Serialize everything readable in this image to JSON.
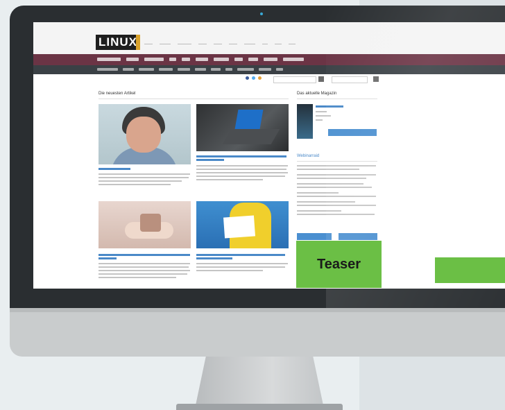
{
  "colors": {
    "accent_green": "#6bbf45",
    "nav_primary": "#6b3445",
    "nav_secondary": "#3a4045",
    "link_blue": "#4a89c8",
    "bezel": "#2a2e31"
  },
  "site": {
    "logo_text": "LINUX",
    "latest_heading": "Die neuesten Artikel",
    "magazine_heading": "Das aktuelle Magazin",
    "webinar_heading": "Webinarraid"
  },
  "overlay": {
    "teaser_label": "Teaser"
  },
  "icons": {
    "camera": "camera-dot-icon",
    "search": "search-icon",
    "menu": "menu-icon"
  }
}
